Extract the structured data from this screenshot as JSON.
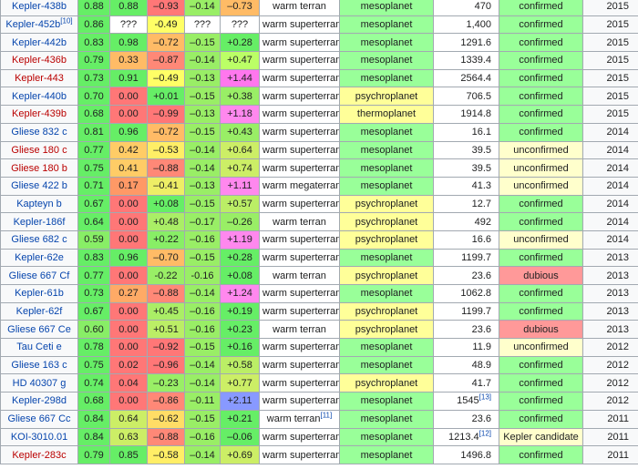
{
  "palette": {
    "green": "#66ff66",
    "light_green": "#99ee66",
    "yellow_green": "#ccee66",
    "lime": "#bbff66",
    "yellow": "#ffff99",
    "orange": "#ffbb66",
    "peach": "#ffaa66",
    "red": "#ff7777",
    "magenta": "#ff88ee",
    "blue": "#8899ff",
    "mesoplanet_bg": "#99ff99",
    "psychroplanet_bg": "#ffff99",
    "thermoplanet_bg": "#ffff99",
    "confirmed_bg": "#99ff99",
    "unconfirmed_bg": "#ffffcc",
    "dubious_bg": "#ff9999",
    "candidate_bg": "#ffffcc"
  },
  "rows": [
    {
      "name": "Kepler-438b",
      "link": "blue",
      "esi": "0.88",
      "esi_c": "#66ee66",
      "sph": "0.88",
      "sph_c": "#66ee66",
      "ht": "–0.93",
      "ht_c": "#ff7777",
      "hp": "–0.14",
      "hp_c": "#99ee66",
      "hv": "–0.73",
      "hv_c": "#ffbb66",
      "type": "warm terran",
      "type_sup": "",
      "class": "mesoplanet",
      "class_c": "#99ff99",
      "dist": "470",
      "dist_sup": "",
      "status": "confirmed",
      "status_c": "#99ff99",
      "year": "2015"
    },
    {
      "name": "Kepler-452b",
      "link": "blue",
      "name_sup": "[10]",
      "esi": "0.86",
      "esi_c": "#66ee66",
      "sph": "???",
      "sph_c": "#ffffff",
      "ht": "-0.49",
      "ht_c": "#ffff66",
      "hp": "???",
      "hp_c": "#ffffff",
      "hv": "???",
      "hv_c": "#ffffff",
      "type": "warm superterran",
      "type_sup": "",
      "class": "mesoplanet",
      "class_c": "#99ff99",
      "dist": "1,400",
      "dist_sup": "",
      "status": "confirmed",
      "status_c": "#99ff99",
      "year": "2015"
    },
    {
      "name": "Kepler-442b",
      "link": "blue",
      "esi": "0.83",
      "esi_c": "#66ee66",
      "sph": "0.98",
      "sph_c": "#66ee66",
      "ht": "–0.72",
      "ht_c": "#ffbb66",
      "hp": "–0.15",
      "hp_c": "#99ee66",
      "hv": "+0.28",
      "hv_c": "#66ee66",
      "type": "warm superterran",
      "type_sup": "",
      "class": "mesoplanet",
      "class_c": "#99ff99",
      "dist": "1291.6",
      "dist_sup": "",
      "status": "confirmed",
      "status_c": "#99ff99",
      "year": "2015"
    },
    {
      "name": "Kepler-436b",
      "link": "red",
      "esi": "0.79",
      "esi_c": "#66ee66",
      "sph": "0.33",
      "sph_c": "#ffbb66",
      "ht": "–0.87",
      "ht_c": "#ff8877",
      "hp": "–0.14",
      "hp_c": "#99ee66",
      "hv": "+0.47",
      "hv_c": "#bbff66",
      "type": "warm superterran",
      "type_sup": "",
      "class": "mesoplanet",
      "class_c": "#99ff99",
      "dist": "1339.4",
      "dist_sup": "",
      "status": "confirmed",
      "status_c": "#99ff99",
      "year": "2015"
    },
    {
      "name": "Kepler-443",
      "link": "red",
      "esi": "0.73",
      "esi_c": "#66ee66",
      "sph": "0.91",
      "sph_c": "#66ee66",
      "ht": "–0.49",
      "ht_c": "#ffff66",
      "hp": "–0.13",
      "hp_c": "#99ee66",
      "hv": "+1.44",
      "hv_c": "#ff77ee",
      "type": "warm superterran",
      "type_sup": "",
      "class": "mesoplanet",
      "class_c": "#99ff99",
      "dist": "2564.4",
      "dist_sup": "",
      "status": "confirmed",
      "status_c": "#99ff99",
      "year": "2015"
    },
    {
      "name": "Kepler-440b",
      "link": "blue",
      "esi": "0.70",
      "esi_c": "#66ee66",
      "sph": "0.00",
      "sph_c": "#ff7777",
      "ht": "+0.01",
      "ht_c": "#66ee66",
      "hp": "–0.15",
      "hp_c": "#99ee66",
      "hv": "+0.38",
      "hv_c": "#99ee66",
      "type": "warm superterran",
      "type_sup": "",
      "class": "psychroplanet",
      "class_c": "#ffff99",
      "dist": "706.5",
      "dist_sup": "",
      "status": "confirmed",
      "status_c": "#99ff99",
      "year": "2015"
    },
    {
      "name": "Kepler-439b",
      "link": "red",
      "esi": "0.68",
      "esi_c": "#66ee66",
      "sph": "0.00",
      "sph_c": "#ff7777",
      "ht": "–0.99",
      "ht_c": "#ff7777",
      "hp": "–0.13",
      "hp_c": "#99ee66",
      "hv": "+1.18",
      "hv_c": "#ff88ee",
      "type": "warm superterran",
      "type_sup": "",
      "class": "thermoplanet",
      "class_c": "#ffff99",
      "dist": "1914.8",
      "dist_sup": "",
      "status": "confirmed",
      "status_c": "#99ff99",
      "year": "2015"
    },
    {
      "name": "Gliese 832 c",
      "link": "blue",
      "esi": "0.81",
      "esi_c": "#66ee66",
      "sph": "0.96",
      "sph_c": "#66ee66",
      "ht": "–0.72",
      "ht_c": "#ffbb66",
      "hp": "–0.15",
      "hp_c": "#99ee66",
      "hv": "+0.43",
      "hv_c": "#99ee66",
      "type": "warm superterran",
      "type_sup": "",
      "class": "mesoplanet",
      "class_c": "#99ff99",
      "dist": "16.1",
      "dist_sup": "",
      "status": "confirmed",
      "status_c": "#99ff99",
      "year": "2014"
    },
    {
      "name": "Gliese 180 c",
      "link": "red",
      "esi": "0.77",
      "esi_c": "#66ee66",
      "sph": "0.42",
      "sph_c": "#ffcc66",
      "ht": "–0.53",
      "ht_c": "#ffee66",
      "hp": "–0.14",
      "hp_c": "#99ee66",
      "hv": "+0.64",
      "hv_c": "#ccee66",
      "type": "warm superterran",
      "type_sup": "",
      "class": "mesoplanet",
      "class_c": "#99ff99",
      "dist": "39.5",
      "dist_sup": "",
      "status": "unconfirmed",
      "status_c": "#ffffcc",
      "year": "2014"
    },
    {
      "name": "Gliese 180 b",
      "link": "red",
      "esi": "0.75",
      "esi_c": "#66ee66",
      "sph": "0.41",
      "sph_c": "#ffcc66",
      "ht": "–0.88",
      "ht_c": "#ff8877",
      "hp": "–0.14",
      "hp_c": "#99ee66",
      "hv": "+0.74",
      "hv_c": "#ccee66",
      "type": "warm superterran",
      "type_sup": "",
      "class": "mesoplanet",
      "class_c": "#99ff99",
      "dist": "39.5",
      "dist_sup": "",
      "status": "unconfirmed",
      "status_c": "#ffffcc",
      "year": "2014"
    },
    {
      "name": "Gliese 422 b",
      "link": "blue",
      "esi": "0.71",
      "esi_c": "#66ee66",
      "sph": "0.17",
      "sph_c": "#ff9966",
      "ht": "–0.41",
      "ht_c": "#eeee66",
      "hp": "–0.13",
      "hp_c": "#99ee66",
      "hv": "+1.11",
      "hv_c": "#ff88ee",
      "type": "warm megaterran",
      "type_sup": "",
      "class": "mesoplanet",
      "class_c": "#99ff99",
      "dist": "41.3",
      "dist_sup": "",
      "status": "unconfirmed",
      "status_c": "#ffffcc",
      "year": "2014"
    },
    {
      "name": "Kapteyn b",
      "link": "blue",
      "esi": "0.67",
      "esi_c": "#66ee66",
      "sph": "0.00",
      "sph_c": "#ff7777",
      "ht": "+0.08",
      "ht_c": "#66ee66",
      "hp": "–0.15",
      "hp_c": "#99ee66",
      "hv": "+0.57",
      "hv_c": "#bbee66",
      "type": "warm superterran",
      "type_sup": "",
      "class": "psychroplanet",
      "class_c": "#ffff99",
      "dist": "12.7",
      "dist_sup": "",
      "status": "confirmed",
      "status_c": "#99ff99",
      "year": "2014"
    },
    {
      "name": "Kepler-186f",
      "link": "blue",
      "esi": "0.64",
      "esi_c": "#66ee66",
      "sph": "0.00",
      "sph_c": "#ff7777",
      "ht": "+0.48",
      "ht_c": "#aaee66",
      "hp": "–0.17",
      "hp_c": "#99ee66",
      "hv": "–0.26",
      "hv_c": "#99ee66",
      "type": "warm terran",
      "type_sup": "",
      "class": "psychroplanet",
      "class_c": "#ffff99",
      "dist": "492",
      "dist_sup": "",
      "status": "confirmed",
      "status_c": "#99ff99",
      "year": "2014"
    },
    {
      "name": "Gliese 682 c",
      "link": "blue",
      "esi": "0.59",
      "esi_c": "#88ee66",
      "sph": "0.00",
      "sph_c": "#ff7777",
      "ht": "+0.22",
      "ht_c": "#88ee66",
      "hp": "–0.16",
      "hp_c": "#99ee66",
      "hv": "+1.19",
      "hv_c": "#ff88ee",
      "type": "warm superterran",
      "type_sup": "",
      "class": "psychroplanet",
      "class_c": "#ffff99",
      "dist": "16.6",
      "dist_sup": "",
      "status": "unconfirmed",
      "status_c": "#ffffcc",
      "year": "2014"
    },
    {
      "name": "Kepler-62e",
      "link": "blue",
      "esi": "0.83",
      "esi_c": "#66ee66",
      "sph": "0.96",
      "sph_c": "#66ee66",
      "ht": "–0.70",
      "ht_c": "#ffbb66",
      "hp": "–0.15",
      "hp_c": "#99ee66",
      "hv": "+0.28",
      "hv_c": "#66ee66",
      "type": "warm superterran",
      "type_sup": "",
      "class": "mesoplanet",
      "class_c": "#99ff99",
      "dist": "1199.7",
      "dist_sup": "",
      "status": "confirmed",
      "status_c": "#99ff99",
      "year": "2013"
    },
    {
      "name": "Gliese 667 Cf",
      "link": "blue",
      "esi": "0.77",
      "esi_c": "#66ee66",
      "sph": "0.00",
      "sph_c": "#ff7777",
      "ht": "-0.22",
      "ht_c": "#99ee66",
      "hp": "-0.16",
      "hp_c": "#99ee66",
      "hv": "+0.08",
      "hv_c": "#66ee66",
      "type": "warm terran",
      "type_sup": "",
      "class": "psychroplanet",
      "class_c": "#ffff99",
      "dist": "23.6",
      "dist_sup": "",
      "status": "dubious",
      "status_c": "#ff9999",
      "year": "2013"
    },
    {
      "name": "Kepler-61b",
      "link": "blue",
      "esi": "0.73",
      "esi_c": "#66ee66",
      "sph": "0.27",
      "sph_c": "#ffaa66",
      "ht": "–0.88",
      "ht_c": "#ff8877",
      "hp": "–0.14",
      "hp_c": "#99ee66",
      "hv": "+1.24",
      "hv_c": "#ff88ee",
      "type": "warm superterran",
      "type_sup": "",
      "class": "mesoplanet",
      "class_c": "#99ff99",
      "dist": "1062.8",
      "dist_sup": "",
      "status": "confirmed",
      "status_c": "#99ff99",
      "year": "2013"
    },
    {
      "name": "Kepler-62f",
      "link": "blue",
      "esi": "0.67",
      "esi_c": "#66ee66",
      "sph": "0.00",
      "sph_c": "#ff7777",
      "ht": "+0.45",
      "ht_c": "#aaee66",
      "hp": "–0.16",
      "hp_c": "#99ee66",
      "hv": "+0.19",
      "hv_c": "#66ee66",
      "type": "warm superterran",
      "type_sup": "",
      "class": "psychroplanet",
      "class_c": "#ffff99",
      "dist": "1199.7",
      "dist_sup": "",
      "status": "confirmed",
      "status_c": "#99ff99",
      "year": "2013"
    },
    {
      "name": "Gliese 667 Ce",
      "link": "blue",
      "esi": "0.60",
      "esi_c": "#88ee66",
      "sph": "0.00",
      "sph_c": "#ff7777",
      "ht": "+0.51",
      "ht_c": "#bbee66",
      "hp": "–0.16",
      "hp_c": "#99ee66",
      "hv": "+0.23",
      "hv_c": "#66ee66",
      "type": "warm terran",
      "type_sup": "",
      "class": "psychroplanet",
      "class_c": "#ffff99",
      "dist": "23.6",
      "dist_sup": "",
      "status": "dubious",
      "status_c": "#ff9999",
      "year": "2013"
    },
    {
      "name": "Tau Ceti e",
      "link": "blue",
      "esi": "0.78",
      "esi_c": "#66ee66",
      "sph": "0.00",
      "sph_c": "#ff7777",
      "ht": "–0.92",
      "ht_c": "#ff7777",
      "hp": "–0.15",
      "hp_c": "#99ee66",
      "hv": "+0.16",
      "hv_c": "#66ee66",
      "type": "warm superterran",
      "type_sup": "",
      "class": "mesoplanet",
      "class_c": "#99ff99",
      "dist": "11.9",
      "dist_sup": "",
      "status": "unconfirmed",
      "status_c": "#ffffcc",
      "year": "2012"
    },
    {
      "name": "Gliese 163 c",
      "link": "blue",
      "esi": "0.75",
      "esi_c": "#66ee66",
      "sph": "0.02",
      "sph_c": "#ff7777",
      "ht": "–0.96",
      "ht_c": "#ff7777",
      "hp": "–0.14",
      "hp_c": "#99ee66",
      "hv": "+0.58",
      "hv_c": "#bbee66",
      "type": "warm superterran",
      "type_sup": "",
      "class": "mesoplanet",
      "class_c": "#99ff99",
      "dist": "48.9",
      "dist_sup": "",
      "status": "confirmed",
      "status_c": "#99ff99",
      "year": "2012"
    },
    {
      "name": "HD 40307 g",
      "link": "blue",
      "esi": "0.74",
      "esi_c": "#66ee66",
      "sph": "0.04",
      "sph_c": "#ff7777",
      "ht": "–0.23",
      "ht_c": "#99ee66",
      "hp": "–0.14",
      "hp_c": "#99ee66",
      "hv": "+0.77",
      "hv_c": "#ccee66",
      "type": "warm superterran",
      "type_sup": "",
      "class": "psychroplanet",
      "class_c": "#ffff99",
      "dist": "41.7",
      "dist_sup": "",
      "status": "confirmed",
      "status_c": "#99ff99",
      "year": "2012"
    },
    {
      "name": "Kepler-298d",
      "link": "blue",
      "esi": "0.68",
      "esi_c": "#66ee66",
      "sph": "0.00",
      "sph_c": "#ff7777",
      "ht": "–0.86",
      "ht_c": "#ff8877",
      "hp": "–0.11",
      "hp_c": "#99ee66",
      "hv": "+2.11",
      "hv_c": "#8899ff",
      "type": "warm superterran",
      "type_sup": "",
      "class": "mesoplanet",
      "class_c": "#99ff99",
      "dist": "1545",
      "dist_sup": "[13]",
      "status": "confirmed",
      "status_c": "#99ff99",
      "year": "2012"
    },
    {
      "name": "Gliese 667 Cc",
      "link": "blue",
      "esi": "0.84",
      "esi_c": "#66ee66",
      "sph": "0.64",
      "sph_c": "#ccee66",
      "ht": "–0.62",
      "ht_c": "#ffdd66",
      "hp": "–0.15",
      "hp_c": "#99ee66",
      "hv": "+0.21",
      "hv_c": "#66ee66",
      "type": "warm terran",
      "type_sup": "[11]",
      "class": "mesoplanet",
      "class_c": "#99ff99",
      "dist": "23.6",
      "dist_sup": "",
      "status": "confirmed",
      "status_c": "#99ff99",
      "year": "2011"
    },
    {
      "name": "KOI-3010.01",
      "link": "blue",
      "esi": "0.84",
      "esi_c": "#66ee66",
      "sph": "0.63",
      "sph_c": "#ccee66",
      "ht": "–0.88",
      "ht_c": "#ff8877",
      "hp": "–0.16",
      "hp_c": "#99ee66",
      "hv": "–0.06",
      "hv_c": "#66ee66",
      "type": "warm superterran",
      "type_sup": "",
      "class": "mesoplanet",
      "class_c": "#99ff99",
      "dist": "1213.4",
      "dist_sup": "[12]",
      "status": "Kepler candidate",
      "status_c": "#ffffcc",
      "year": "2011"
    },
    {
      "name": "Kepler-283c",
      "link": "red",
      "esi": "0.79",
      "esi_c": "#66ee66",
      "sph": "0.85",
      "sph_c": "#66ee66",
      "ht": "–0.58",
      "ht_c": "#ffee66",
      "hp": "–0.14",
      "hp_c": "#99ee66",
      "hv": "+0.69",
      "hv_c": "#ccee66",
      "type": "warm superterran",
      "type_sup": "",
      "class": "mesoplanet",
      "class_c": "#99ff99",
      "dist": "1496.8",
      "dist_sup": "",
      "status": "confirmed",
      "status_c": "#99ff99",
      "year": "2011"
    }
  ]
}
